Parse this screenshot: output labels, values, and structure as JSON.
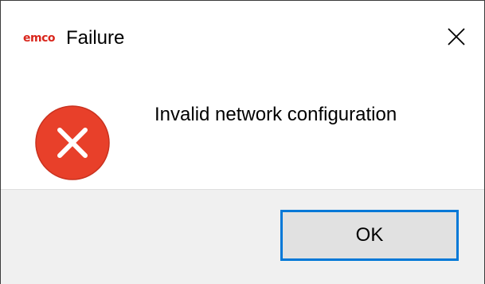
{
  "window": {
    "app_logo": "emco",
    "title": "Failure",
    "close_icon": "close-icon",
    "logo_color": "#d9261c"
  },
  "content": {
    "icon": "error-icon",
    "icon_color": "#e8402a",
    "message": "Invalid network configuration"
  },
  "footer": {
    "ok_label": "OK",
    "focus_color": "#0078d7"
  }
}
